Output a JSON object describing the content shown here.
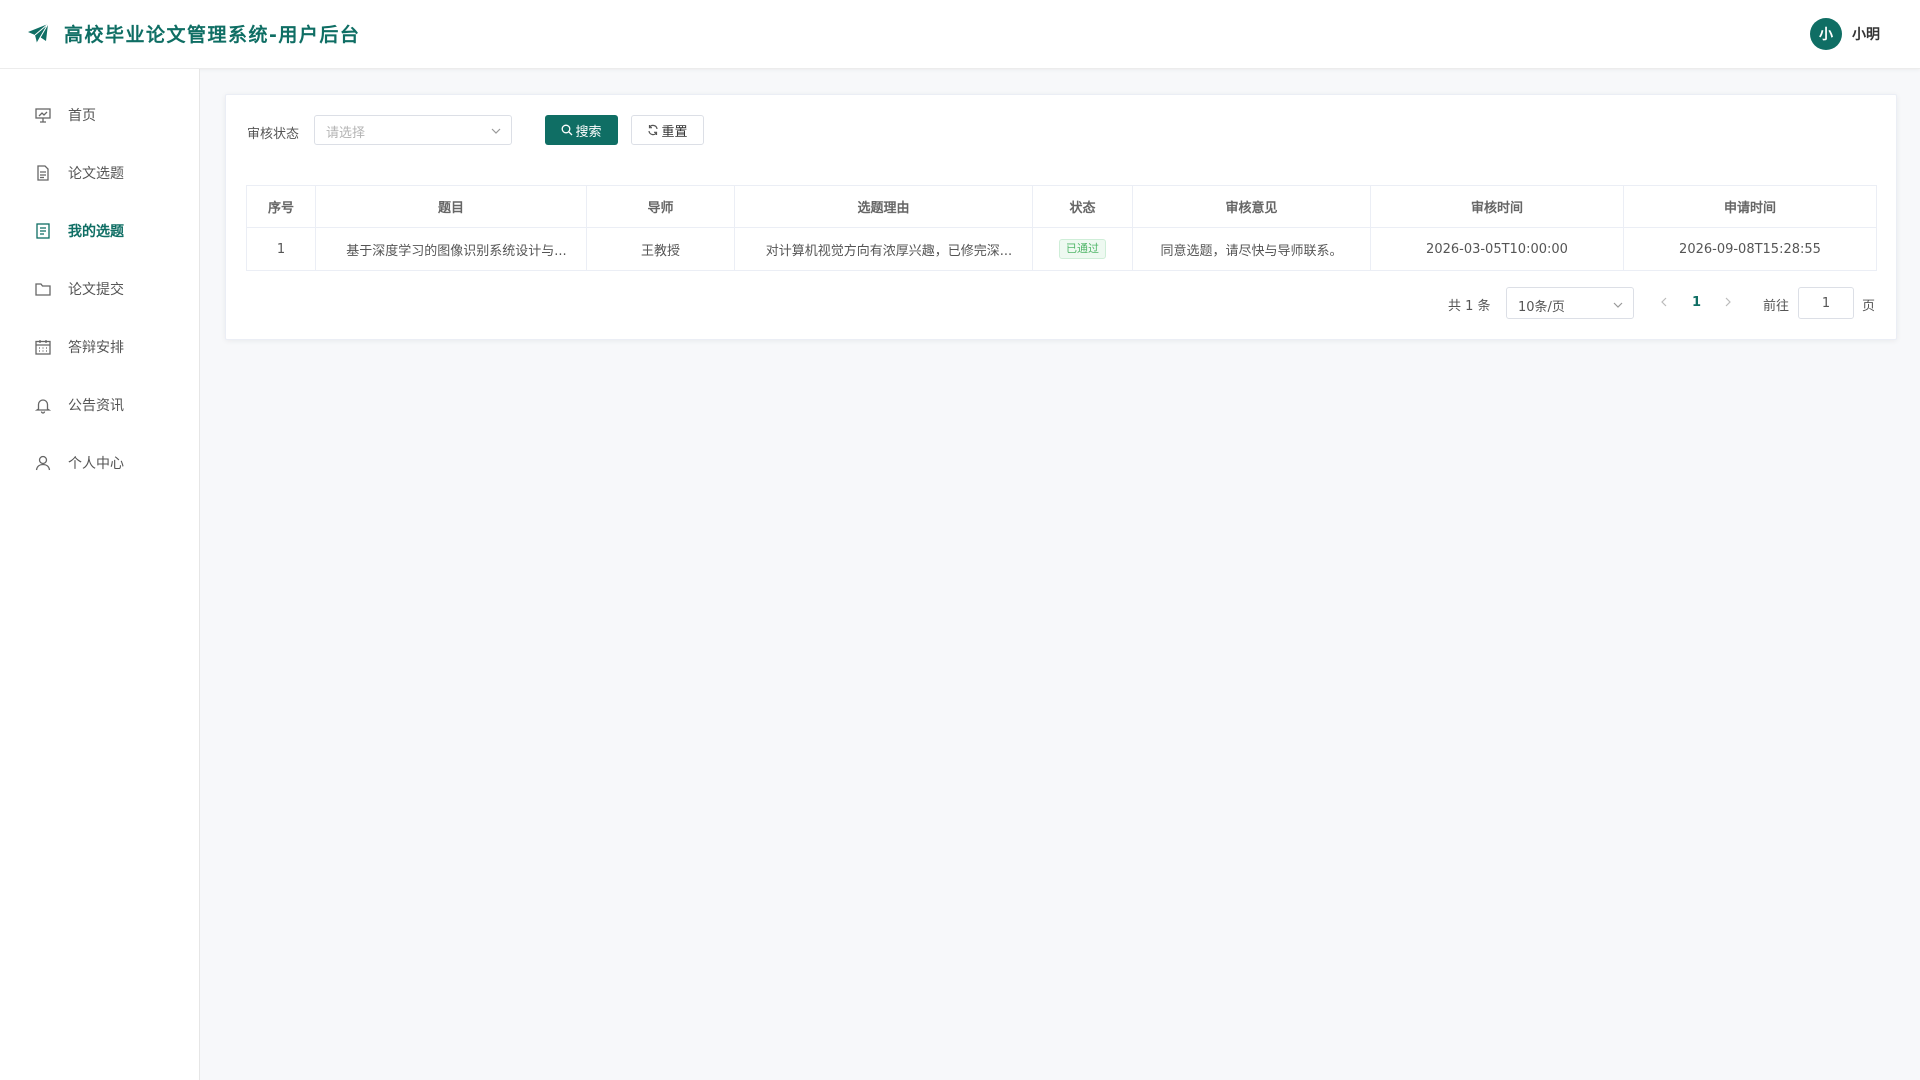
{
  "app": {
    "title": "高校毕业论文管理系统-用户后台",
    "accent_color": "#0f6e64"
  },
  "user": {
    "avatar_text": "小",
    "name": "小明"
  },
  "sidebar": {
    "items": [
      {
        "label": "首页",
        "icon": "presentation-chart-icon"
      },
      {
        "label": "论文选题",
        "icon": "document-icon"
      },
      {
        "label": "我的选题",
        "icon": "document-list-icon",
        "active": true
      },
      {
        "label": "论文提交",
        "icon": "folder-icon"
      },
      {
        "label": "答辩安排",
        "icon": "calendar-icon"
      },
      {
        "label": "公告资讯",
        "icon": "bell-icon"
      },
      {
        "label": "个人中心",
        "icon": "user-icon"
      }
    ]
  },
  "filter": {
    "label": "审核状态",
    "placeholder": "请选择",
    "search_label": "搜索",
    "reset_label": "重置"
  },
  "table": {
    "headers": [
      "序号",
      "题目",
      "导师",
      "选题理由",
      "状态",
      "审核意见",
      "审核时间",
      "申请时间"
    ],
    "rows": [
      {
        "index": "1",
        "title": "基于深度学习的图像识别系统设计与...",
        "advisor": "王教授",
        "reason": "对计算机视觉方向有浓厚兴趣，已修完深...",
        "status": "已通过",
        "opinion": "同意选题，请尽快与导师联系。",
        "review_time": "2026-03-05T10:00:00",
        "apply_time": "2026-09-08T15:28:55"
      }
    ]
  },
  "pagination": {
    "total": "共 1 条",
    "page_size": "10条/页",
    "current": "1",
    "goto_label": "前往",
    "goto_value": "1",
    "page_unit": "页"
  }
}
